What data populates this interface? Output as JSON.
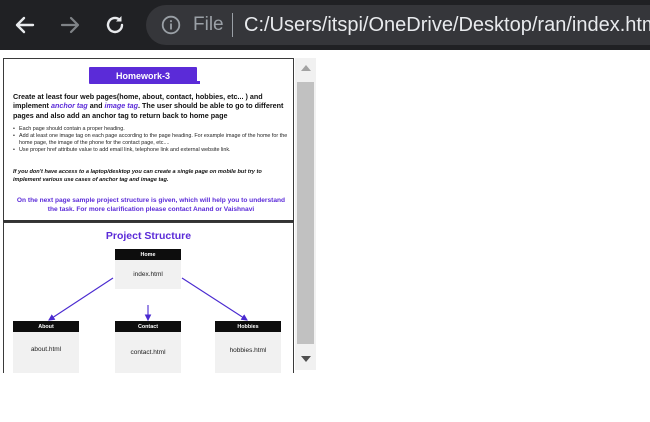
{
  "browser": {
    "scheme_label": "File",
    "url": "C:/Users/itspi/OneDrive/Desktop/ran/index.html",
    "icons": {
      "back": "arrow-left-icon",
      "forward": "arrow-right-icon",
      "reload": "reload-icon",
      "info": "info-icon"
    },
    "colors": {
      "toolbar_bg": "#202124",
      "omnibox_bg": "#35363a"
    }
  },
  "page1": {
    "badge": "Homework-3",
    "intro": {
      "part1": "Create at least four web pages(home, about, contact, hobbies, etc... ) and implement ",
      "anchor_tag": "anchor tag",
      "part2": " and ",
      "image_tag": "image tag",
      "part3": ". The user should be able to go to different pages  and also add an anchor tag to return back to home page"
    },
    "bullets": [
      "Each page should contain a proper heading.",
      "Add at least one image tag on each page according to the page heading. For example image of the home     for the home page, the image of the phone     for the contact page, etc....",
      "Use proper href attribute value to add email link, telephone link and external website link."
    ],
    "note": "If you don't have access to a laptop/desktop you can create a single page on mobile but try to implement various use cases of anchor tag and image tag.",
    "footer": "On the next page sample project structure is given, which will help you to understand the task.  For more clarification please contact Anand or Vaishnavi",
    "accent_color": "#5b2bd8"
  },
  "page2": {
    "title": "Project Structure",
    "nodes": {
      "home": {
        "heading": "Home",
        "file": "index.html"
      },
      "about": {
        "heading": "About",
        "file": "about.html"
      },
      "contact": {
        "heading": "Contact",
        "file": "contact.html"
      },
      "hobbies": {
        "heading": "Hobbies",
        "file": "hobbies.html"
      }
    }
  },
  "scrollbar": {
    "up_icon": "scroll-up-arrow-icon",
    "down_icon": "scroll-down-arrow-icon"
  }
}
